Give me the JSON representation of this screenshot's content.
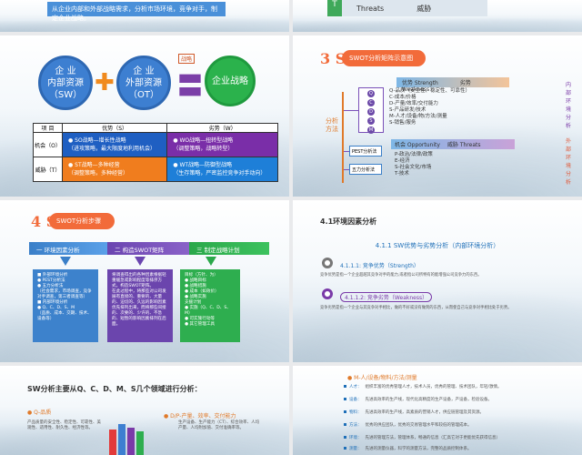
{
  "slide1": {
    "bar_text": "从企业内部和外部战略需求，分析市场环境，竞争对手，制定企业战略。"
  },
  "slide2": {
    "icon_letter": "T",
    "label_threats": "Threats",
    "label_weihe": "威胁"
  },
  "slide3": {
    "circle_sw": [
      "企 业",
      "内部资源",
      "（SW）"
    ],
    "circle_ot": [
      "企 业",
      "外部资源",
      "（OT）"
    ],
    "circle_strategy": "企业战略",
    "tag": "战略",
    "table": {
      "headers": [
        "项 目",
        "优势（S）",
        "劣势（W）"
      ],
      "rows": [
        {
          "label": "机会（O）",
          "cells": [
            "● SO战略—增长性战略",
            "（进攻策略，最大限度地利用机会）",
            "● WO战略—扭转型战略",
            "（调整策略，战略转型）"
          ]
        },
        {
          "label": "威胁（T）",
          "cells": [
            "● ST战略—多种经营",
            "（调整策略，多种经营）",
            "● WT战略—防御型战略",
            "（生存策略，严密监控竞争对手动向）"
          ]
        }
      ]
    }
  },
  "slide4": {
    "number": "3 St",
    "title": "SWOT分析矩阵示意图",
    "vertical_label": "分析方法",
    "header_sw": [
      "优势 Strength",
      "劣势 Weakness"
    ],
    "sw_letters": [
      "Q",
      "C",
      "D",
      "S",
      "M"
    ],
    "sw_list": [
      "Q-品质（安全性、稳定性、可靠性）",
      "C-成本/价格",
      "D-产量/效率/交付能力",
      "S-产品研发/技术",
      "M-人才/设备/物/方法/测量",
      "S-销售/服务"
    ],
    "header_ot": [
      "机会 Opportunity",
      "威胁 Threats"
    ],
    "pest_box": "PEST分析法",
    "force_box": "五力分析法",
    "pest_list": [
      "P-政治/法律/政策",
      "E-经济",
      "S-社会文化/市场",
      "T-技术"
    ],
    "inner_label": "内部环境分析",
    "outer_label": "外部环境分析"
  },
  "slide5": {
    "number": "4 St",
    "title": "SWOT分析步骤",
    "steps": [
      "一  环境因素分析",
      "二  构造SWOT矩阵",
      "三  制定战略计划"
    ],
    "box1": [
      "■ 外部环境分析",
      "● PEST分析法",
      "● 五力分析法",
      "（社会需求，市场调查，竞争对手调查，第三者调查等）",
      "■ 内部环境分析",
      "● Q、C、D、S、M",
      "（品质、成本、交期、技术、设备等）"
    ],
    "box2": [
      "将调查得出的各种因素根据轻重缓急或影响程度等排序方式，构造SWOT矩阵。",
      "在此过程中，将那些对公司发展有直接的、重要的、大量的、迫切的、久远的影响因素优先排列出来，而将那些间接的、次要的、少许的、不急的、短暂的影响因素排列在后面。"
    ],
    "box3": [
      "目标（方针、为）",
      "● 战略目标",
      "● 战略措施",
      "● 成本（如效价）",
      "● 战略实施",
      "支援计划",
      "● 实施（Q、C、D、S、M）",
      "● 可实施行动等",
      "● 其它管理工具"
    ]
  },
  "slide6": {
    "title": "4.1环境因素分析",
    "subtitle": "4.1.1 SW优势与劣势分析（内部环境分析）",
    "items": [
      {
        "code": "4.1.1.1: 竞争优势",
        "en": "（Strength）",
        "text": "竞争优势是指一个企业超越其竞争对手的能力,或者指公司所特有的能增强公司竞争力的东西。"
      },
      {
        "code": "4.1.1.2: 竞争劣势",
        "en": "（Weakness）",
        "text": "竞争劣势是指一个企业与其竞争对手相比，做的不好或没有做到的东西，从而使自己与竞争对手相比处于劣势。"
      }
    ]
  },
  "slide7": {
    "title": "SW分析主要从Q、C、D、M、S几个领域进行分析：",
    "q_title": "Q-品质",
    "q_text": "产品质量的安全性、稳定性、可靠性、美观性、适用性、耐久性、经济性等。",
    "d_title": "D/P-产量、效率、交付能力",
    "d_text": "生产设备、生产能力（CT）、综合效率、人均产量、人均附加值、交付准确率等。"
  },
  "slide8": {
    "head": "M-人/设备/物料/方法/测量",
    "rows": [
      {
        "key": "人才：",
        "text": "组织丰富的优秀管理人才，技术人员，优秀的管理、技术团队，年轻/激情。"
      },
      {
        "key": "设备：",
        "text": "先进高效率的生产线，现代化高精度的生产设备，产设备，检验设备。"
      },
      {
        "key": "物料：",
        "text": "先进高效率的生产线，高素质的营销人才，供应链管理及其资源。"
      },
      {
        "key": "方法：",
        "text": "优秀的供应团队，优秀的交易管理水平和较低的管理成本。"
      },
      {
        "key": "环境：",
        "text": "先进的管理方法，管理体系，畅通的信息（汇高它对于更能优先获得信息）"
      },
      {
        "key": "测量：",
        "text": "先进的测量仪器，科学的测量方法，完整的品质控制体系。"
      }
    ]
  }
}
